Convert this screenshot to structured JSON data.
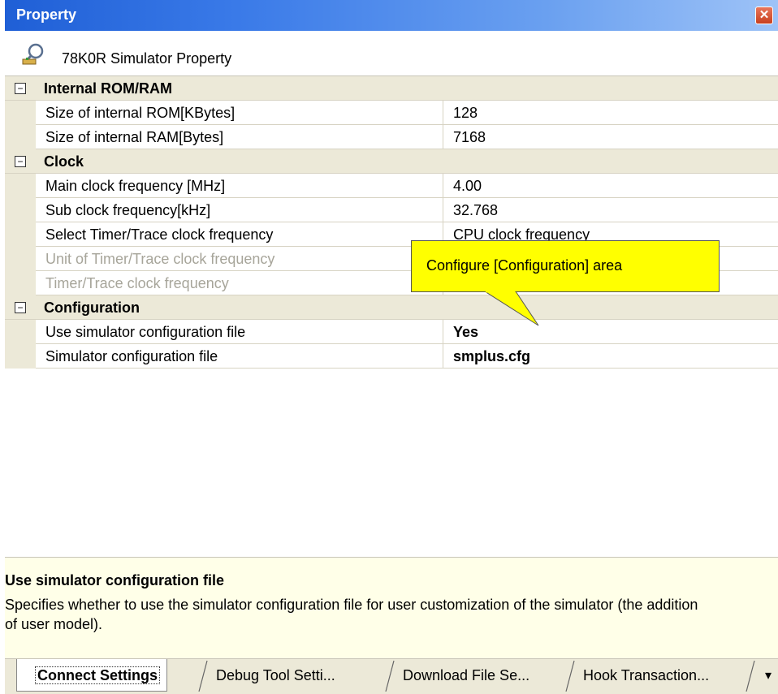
{
  "window": {
    "title": "Property",
    "close_glyph": "✕",
    "header_label": "78K0R Simulator Property"
  },
  "grid": {
    "categories": [
      {
        "label": "Internal ROM/RAM",
        "toggle": "−",
        "properties": [
          {
            "name": "Size of internal ROM[KBytes]",
            "value": "128"
          },
          {
            "name": "Size of internal RAM[Bytes]",
            "value": "7168"
          }
        ]
      },
      {
        "label": "Clock",
        "toggle": "−",
        "properties": [
          {
            "name": "Main clock frequency [MHz]",
            "value": "4.00"
          },
          {
            "name": "Sub clock frequency[kHz]",
            "value": "32.768"
          },
          {
            "name": "Select Timer/Trace clock frequency",
            "value": "CPU clock frequency"
          },
          {
            "name": "Unit of Timer/Trace clock frequency",
            "value": ""
          },
          {
            "name": "Timer/Trace clock frequency",
            "value": "---"
          }
        ]
      },
      {
        "label": "Configuration",
        "toggle": "−",
        "properties": [
          {
            "name": "Use simulator configuration file",
            "value": "Yes"
          },
          {
            "name": "Simulator configuration file",
            "value": "smplus.cfg"
          }
        ]
      }
    ]
  },
  "callout": {
    "text": "Configure [Configuration] area",
    "color": "#ffff00"
  },
  "description": {
    "title": "Use simulator configuration file",
    "body": "Specifies whether to use the simulator configuration file for user customization of the simulator (the addition of user model)."
  },
  "tabs": [
    {
      "label": "Connect Settings",
      "active": true
    },
    {
      "label": "Debug Tool Setti...",
      "active": false
    },
    {
      "label": "Download File Se...",
      "active": false
    },
    {
      "label": "Hook Transaction...",
      "active": false
    }
  ],
  "tab_scroll_glyph": "▾"
}
